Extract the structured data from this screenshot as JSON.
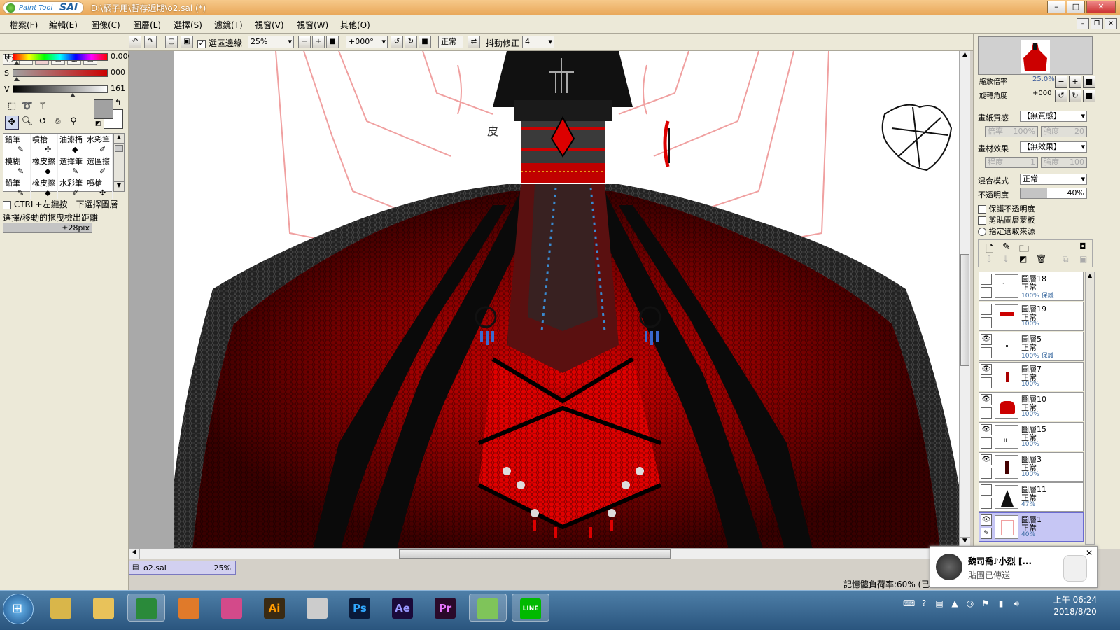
{
  "app": {
    "logo_small": "Paint Tool",
    "logo_big": "SAI",
    "window_title": "D:\\橘子用\\暫存近期\\o2.sai (*)"
  },
  "menu": [
    "檔案(F)",
    "編輯(E)",
    "圖像(C)",
    "圖層(L)",
    "選擇(S)",
    "濾鏡(T)",
    "視窗(V)",
    "視窗(W)",
    "其他(O)"
  ],
  "toolbar": {
    "selection_edge_label": "選區邊緣",
    "zoom_value": "25%",
    "rotation_value": "+000°",
    "blend_label": "正常",
    "stabilizer_label": "抖動修正",
    "stabilizer_value": "4"
  },
  "color": {
    "h_label": "H",
    "h_value": "0.000",
    "s_label": "S",
    "s_value": "000",
    "v_label": "V",
    "v_value": "161",
    "primary": "#a1a1a1"
  },
  "brushes": [
    {
      "label": "鉛筆",
      "icon": "pencil-icon",
      "glyph": "✎"
    },
    {
      "label": "噴槍",
      "icon": "airbrush-icon",
      "glyph": "✣"
    },
    {
      "label": "油漆桶",
      "icon": "bucket-icon",
      "glyph": "◆"
    },
    {
      "label": "水彩筆",
      "icon": "watercolor-icon",
      "glyph": "✐"
    },
    {
      "label": "模糊",
      "icon": "blur-icon",
      "glyph": "✎"
    },
    {
      "label": "橡皮擦",
      "icon": "eraser-icon",
      "glyph": "◆"
    },
    {
      "label": "選擇筆",
      "icon": "select-pen-icon",
      "glyph": "✎"
    },
    {
      "label": "選區擦",
      "icon": "select-eraser-icon",
      "glyph": "✐"
    },
    {
      "label": "鉛筆",
      "icon": "pencil-icon",
      "glyph": "✎"
    },
    {
      "label": "橡皮擦",
      "icon": "eraser-icon",
      "glyph": "◆"
    },
    {
      "label": "水彩筆",
      "icon": "watercolor-icon",
      "glyph": "✐"
    },
    {
      "label": "噴槍",
      "icon": "airbrush-icon",
      "glyph": "✣"
    }
  ],
  "left_options": {
    "ctrl_label": "CTRL+左鍵按一下選擇圖層",
    "drag_label": "選擇/移動的拖曳檢出距離",
    "drag_value": "±28pix"
  },
  "document_tab": {
    "name": "o2.sai",
    "zoom": "25%"
  },
  "navigator": {
    "zoom_label": "縮放倍率",
    "zoom_value": "25.0%",
    "rotate_label": "旋轉角度",
    "rotate_value": "+000"
  },
  "paper": {
    "texture_label": "畫紙質感",
    "texture_value": "【無質感】",
    "scale_label": "倍率",
    "scale_value": "100%",
    "strength_label": "強度",
    "strength_value": "20",
    "effect_label": "畫材效果",
    "effect_value": "【無效果】",
    "degree_label": "程度",
    "degree_value": "1",
    "strength2_label": "強度",
    "strength2_value": "100"
  },
  "layer_props": {
    "blend_label": "混合模式",
    "blend_value": "正常",
    "opacity_label": "不透明度",
    "opacity_value": "40%",
    "opacity_fraction": 0.4,
    "protect_label": "保護不透明度",
    "clip_label": "剪貼圖層蒙板",
    "source_label": "指定選取來源"
  },
  "layers": [
    {
      "name": "圖層18",
      "mode": "正常",
      "opacity": "100% 保護",
      "visible": false,
      "selected": false
    },
    {
      "name": "圖層19",
      "mode": "正常",
      "opacity": "100%",
      "visible": false,
      "selected": false
    },
    {
      "name": "圖層5",
      "mode": "正常",
      "opacity": "100% 保護",
      "visible": true,
      "selected": false
    },
    {
      "name": "圖層7",
      "mode": "正常",
      "opacity": "100%",
      "visible": true,
      "selected": false
    },
    {
      "name": "圖層10",
      "mode": "正常",
      "opacity": "100%",
      "visible": true,
      "selected": false
    },
    {
      "name": "圖層15",
      "mode": "正常",
      "opacity": "100%",
      "visible": true,
      "selected": false
    },
    {
      "name": "圖層3",
      "mode": "正常",
      "opacity": "100%",
      "visible": true,
      "selected": false
    },
    {
      "name": "圖層11",
      "mode": "正常",
      "opacity": "47%",
      "visible": false,
      "selected": false
    },
    {
      "name": "圖層1",
      "mode": "正常",
      "opacity": "40%",
      "visible": true,
      "selected": true
    }
  ],
  "status": {
    "memory": "記憶體負荷率:60% (已用"
  },
  "notification": {
    "name": "魏司喬♪小烈 [...",
    "message": "貼圖已傳送"
  },
  "taskbar": {
    "apps": [
      {
        "name": "explorer-app",
        "label": "",
        "color": "#d9b64a"
      },
      {
        "name": "folder-app",
        "label": "",
        "color": "#e8c25a"
      },
      {
        "name": "chrome-app",
        "label": "",
        "color": "#2a8a3a"
      },
      {
        "name": "media-app",
        "label": "",
        "color": "#e07a2a"
      },
      {
        "name": "picasa-app",
        "label": "",
        "color": "#d34a8a"
      },
      {
        "name": "illustrator-app",
        "label": "Ai",
        "color": "#3a2a12",
        "text": "#ff9a00"
      },
      {
        "name": "zbrush-app",
        "label": "",
        "color": "#cccccc"
      },
      {
        "name": "photoshop-app",
        "label": "Ps",
        "color": "#0a1a3a",
        "text": "#31a8ff"
      },
      {
        "name": "aftereffects-app",
        "label": "Ae",
        "color": "#1a0a3a",
        "text": "#9999ff"
      },
      {
        "name": "premiere-app",
        "label": "Pr",
        "color": "#2a0a2a",
        "text": "#ea77ff"
      },
      {
        "name": "sai-app",
        "label": "",
        "color": "#7fc45a"
      },
      {
        "name": "line-app",
        "label": "LINE",
        "color": "#00b900",
        "text": "#ffffff"
      }
    ],
    "time": "上午 06:24",
    "date": "2018/8/20"
  }
}
